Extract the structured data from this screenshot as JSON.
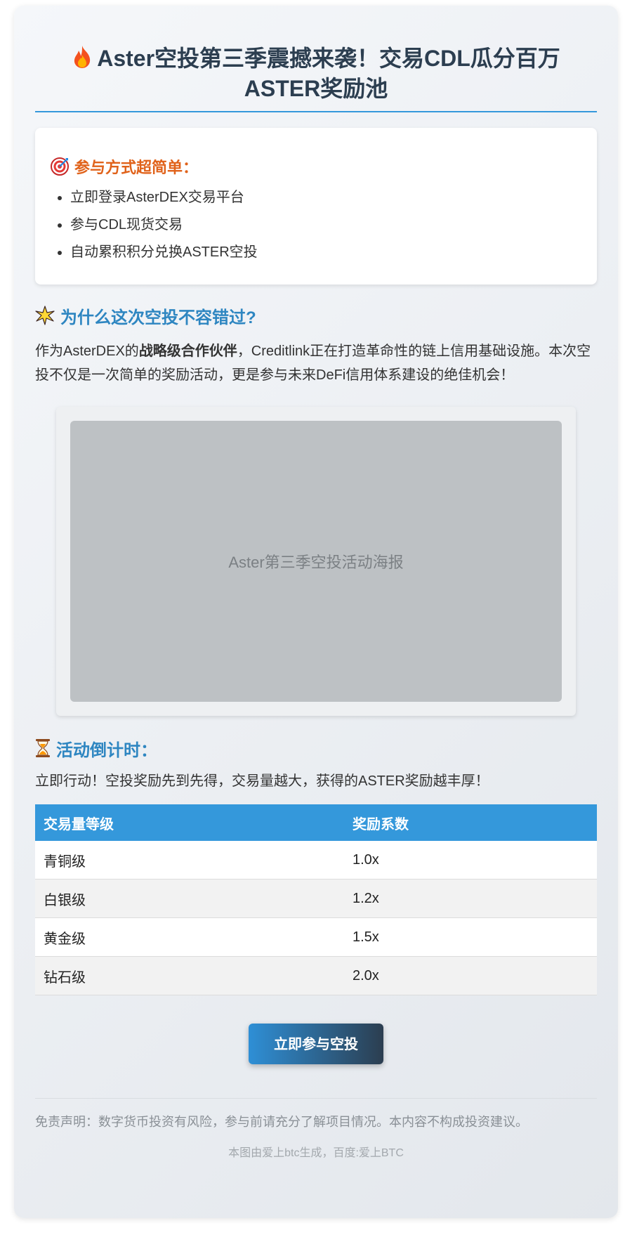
{
  "header": {
    "title": "Aster空投第三季震撼来袭！交易CDL瓜分百万ASTER奖励池",
    "title_icon": "fire-icon"
  },
  "steps": {
    "icon": "target-icon",
    "heading": "参与方式超简单：",
    "items": [
      "立即登录AsterDEX交易平台",
      "参与CDL现货交易",
      "自动累积积分兑换ASTER空投"
    ]
  },
  "why": {
    "icon": "sparkle-icon",
    "heading": "为什么这次空投不容错过?",
    "text_before": "作为AsterDEX的",
    "text_bold": "战略级合作伙伴",
    "text_after": "，Creditlink正在打造革命性的链上信用基础设施。本次空投不仅是一次简单的奖励活动，更是参与未来DeFi信用体系建设的绝佳机会！"
  },
  "poster": {
    "caption": "Aster第三季空投活动海报"
  },
  "countdown": {
    "icon": "hourglass-icon",
    "heading": "活动倒计时：",
    "text": "立即行动！空投奖励先到先得，交易量越大，获得的ASTER奖励越丰厚！"
  },
  "tier_table": {
    "headers": [
      "交易量等级",
      "奖励系数"
    ],
    "rows": [
      [
        "青铜级",
        "1.0x"
      ],
      [
        "白银级",
        "1.2x"
      ],
      [
        "黄金级",
        "1.5x"
      ],
      [
        "钻石级",
        "2.0x"
      ]
    ]
  },
  "cta": {
    "label": "立即参与空投"
  },
  "footer": {
    "disclaimer": "免责声明：数字货币投资有风险，参与前请充分了解项目情况。本内容不构成投资建议。",
    "credit": "本图由爱上btc生成，百度:爱上BTC"
  },
  "colors": {
    "accent_blue": "#3498db",
    "heading_blue": "#2e86c1",
    "orange": "#e0621a",
    "title_dark": "#2c3e50"
  }
}
